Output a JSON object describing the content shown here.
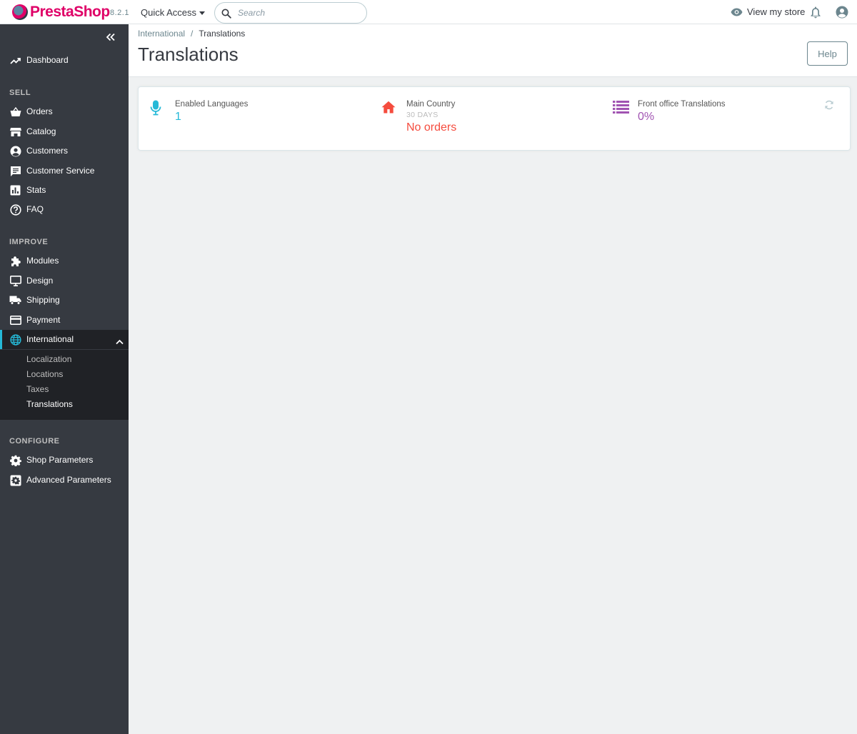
{
  "header": {
    "logo_text_a": "Presta",
    "logo_text_b": "Shop",
    "version": "8.2.1",
    "quick_access": "Quick Access",
    "search_placeholder": "Search",
    "view_store": "View my store"
  },
  "sidebar": {
    "items_sell_section": "SELL",
    "items_improve_section": "IMPROVE",
    "items_configure_section": "CONFIGURE",
    "dashboard": "Dashboard",
    "orders": "Orders",
    "catalog": "Catalog",
    "customers": "Customers",
    "customer_service": "Customer Service",
    "stats": "Stats",
    "faq": "FAQ",
    "modules": "Modules",
    "design": "Design",
    "shipping": "Shipping",
    "payment": "Payment",
    "international": "International",
    "sub": {
      "localization": "Localization",
      "locations": "Locations",
      "taxes": "Taxes",
      "translations": "Translations"
    },
    "shop_parameters": "Shop Parameters",
    "advanced_parameters": "Advanced Parameters"
  },
  "page": {
    "breadcrumb_parent": "International",
    "breadcrumb_sep": "/",
    "breadcrumb_current": "Translations",
    "title": "Translations",
    "help": "Help"
  },
  "kpis": {
    "languages": {
      "title": "Enabled Languages",
      "value": "1",
      "color": "#25b9d7"
    },
    "country": {
      "title": "Main Country",
      "subtitle": "30 DAYS",
      "value": "No orders",
      "color": "#f54c3e"
    },
    "translations": {
      "title": "Front office Translations",
      "value": "0%",
      "color": "#a154b2"
    }
  },
  "colors": {
    "sidebar_bg": "#363a41",
    "sidebar_active_bg": "#202226",
    "accent": "#25b9d7",
    "brand": "#df0067"
  }
}
